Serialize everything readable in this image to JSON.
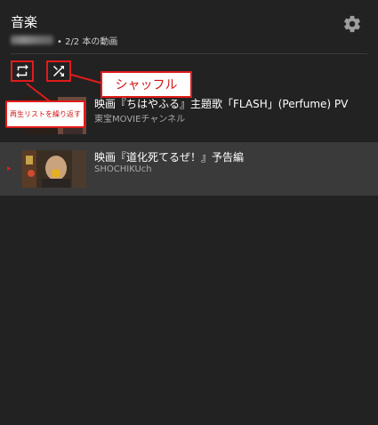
{
  "header": {
    "title": "音楽",
    "video_count": "• 2/2 本の動画"
  },
  "controls": {
    "loop_icon": "repeat-icon",
    "shuffle_icon": "shuffle-icon",
    "settings_icon": "gear-icon"
  },
  "annotations": {
    "shuffle_label": "シャッフル",
    "loop_label": "再生リストを繰り返す"
  },
  "playlist": {
    "items": [
      {
        "title": "映画『ちはやふる』主題歌「FLASH」(Perfume) PV",
        "channel": "東宝MOVIEチャンネル",
        "playing": false
      },
      {
        "title": "映画『道化死てるぜ！』予告編",
        "channel": "SHOCHIKUch",
        "playing": true,
        "indicator": "▶"
      }
    ]
  },
  "colors": {
    "background": "#222222",
    "selected_row": "#3a3a3a",
    "annotation_red": "#e11b1b",
    "icon": "#ffffff",
    "gear": "#9e9e9e"
  }
}
